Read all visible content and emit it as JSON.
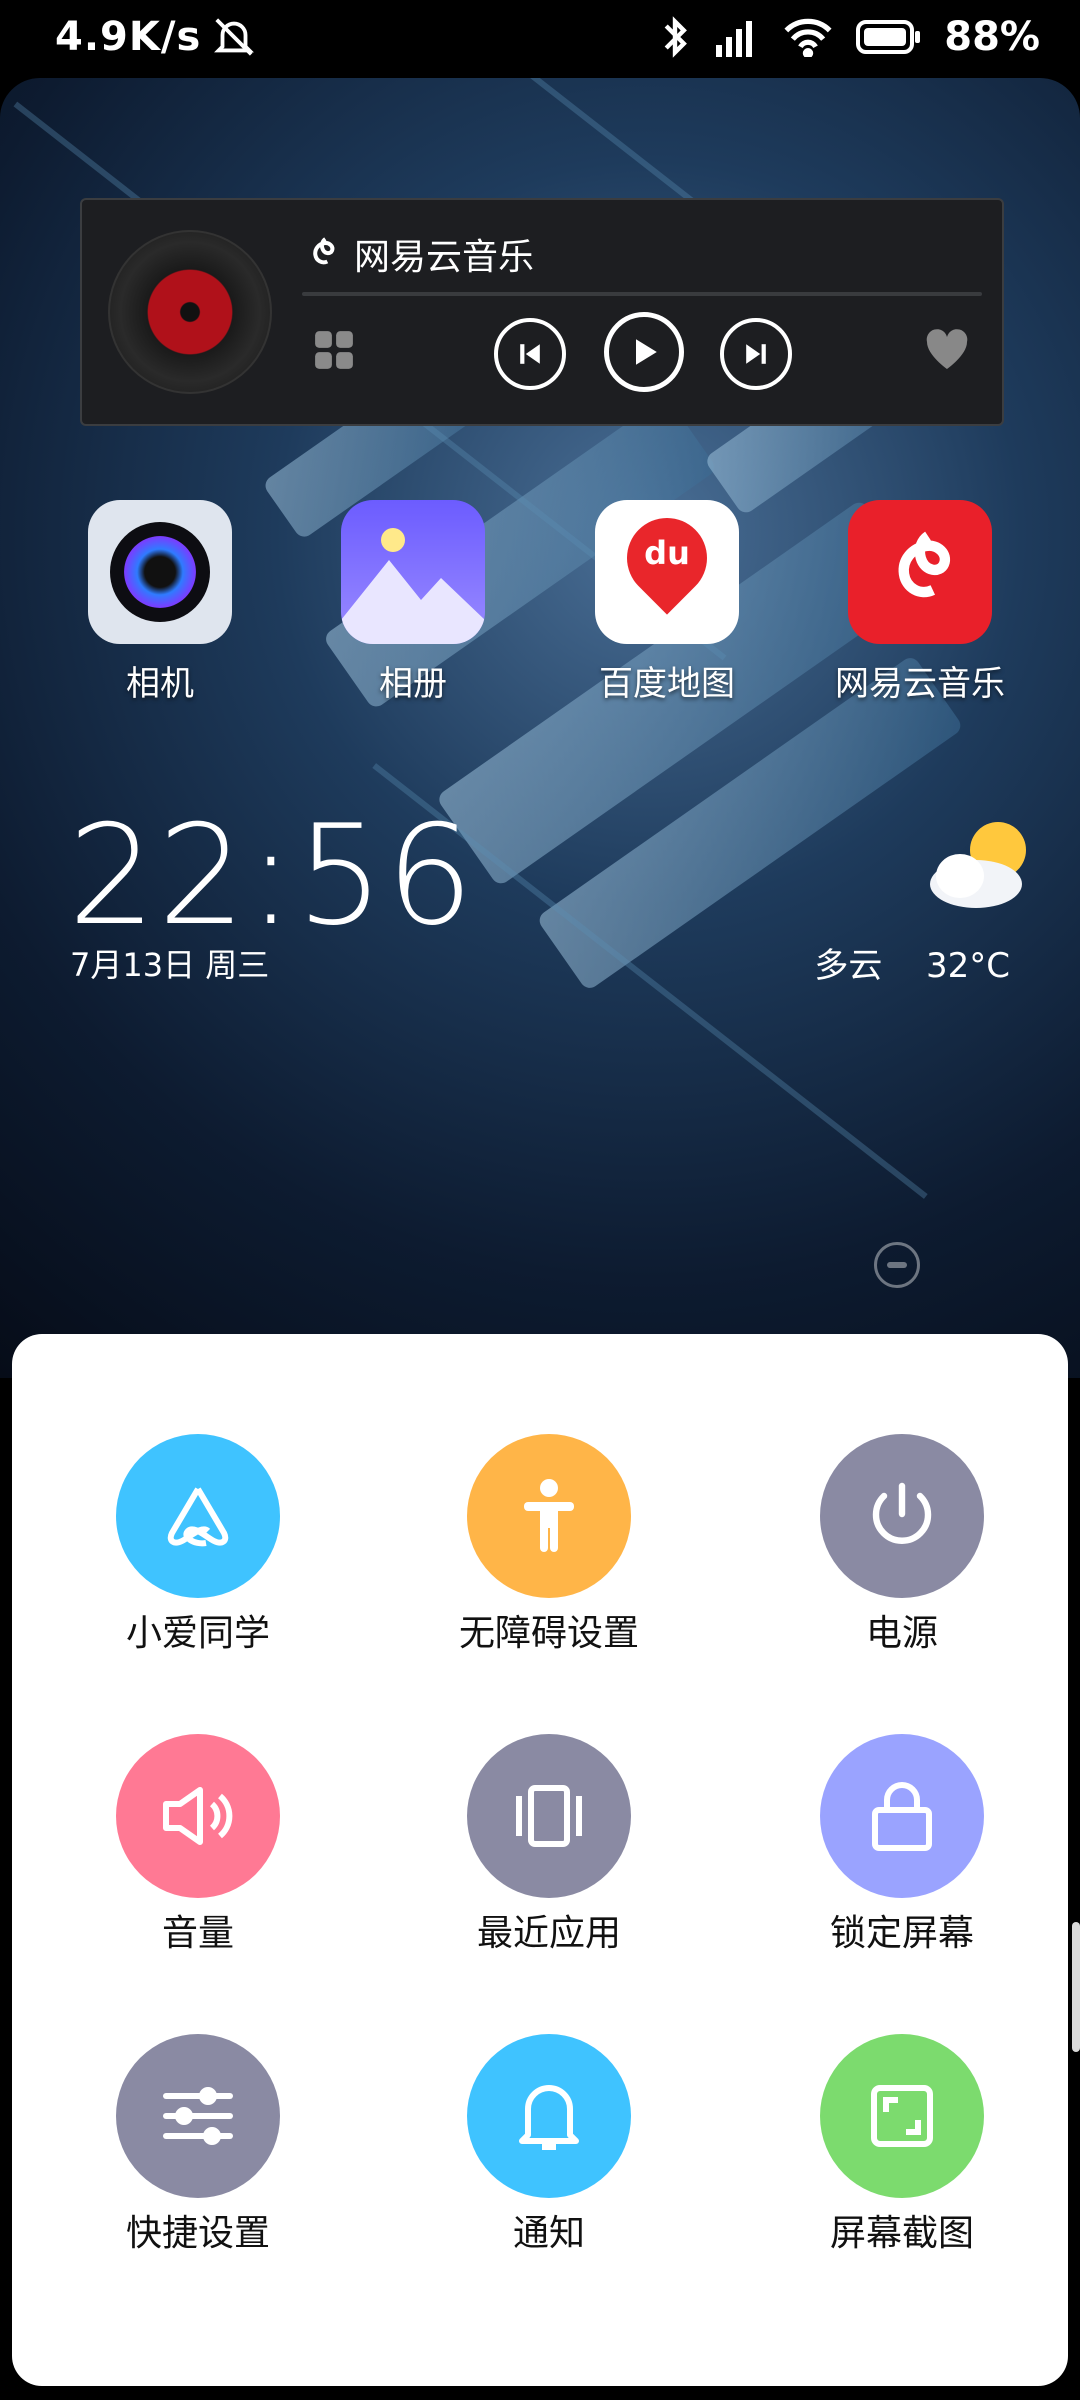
{
  "status_bar": {
    "speed": "4.9K/s",
    "battery": "88%"
  },
  "music_widget": {
    "app_name": "网易云音乐"
  },
  "apps": [
    {
      "label": "相机",
      "icon": "camera-icon"
    },
    {
      "label": "相册",
      "icon": "gallery-icon"
    },
    {
      "label": "百度地图",
      "icon": "baidu-map-icon",
      "badge_text": "du"
    },
    {
      "label": "网易云音乐",
      "icon": "netease-music-icon"
    }
  ],
  "clock": {
    "time": "22:56",
    "date": "7月13日 周三"
  },
  "weather": {
    "condition": "多云",
    "temp": "32°C"
  },
  "menu": {
    "items": [
      {
        "label": "小爱同学",
        "color": "#3fc3ff",
        "icon": "xiaoai-icon"
      },
      {
        "label": "无障碍设置",
        "color": "#ffb548",
        "icon": "accessibility-icon"
      },
      {
        "label": "电源",
        "color": "#8a8aa3",
        "icon": "power-icon"
      },
      {
        "label": "音量",
        "color": "#ff7994",
        "icon": "volume-icon"
      },
      {
        "label": "最近应用",
        "color": "#8a8aa3",
        "icon": "recent-apps-icon"
      },
      {
        "label": "锁定屏幕",
        "color": "#9aa3ff",
        "icon": "lock-icon"
      },
      {
        "label": "快捷设置",
        "color": "#8a8aa3",
        "icon": "quick-settings-icon"
      },
      {
        "label": "通知",
        "color": "#3fc3ff",
        "icon": "bell-icon"
      },
      {
        "label": "屏幕截图",
        "color": "#7cdb6e",
        "icon": "screenshot-icon"
      }
    ]
  }
}
